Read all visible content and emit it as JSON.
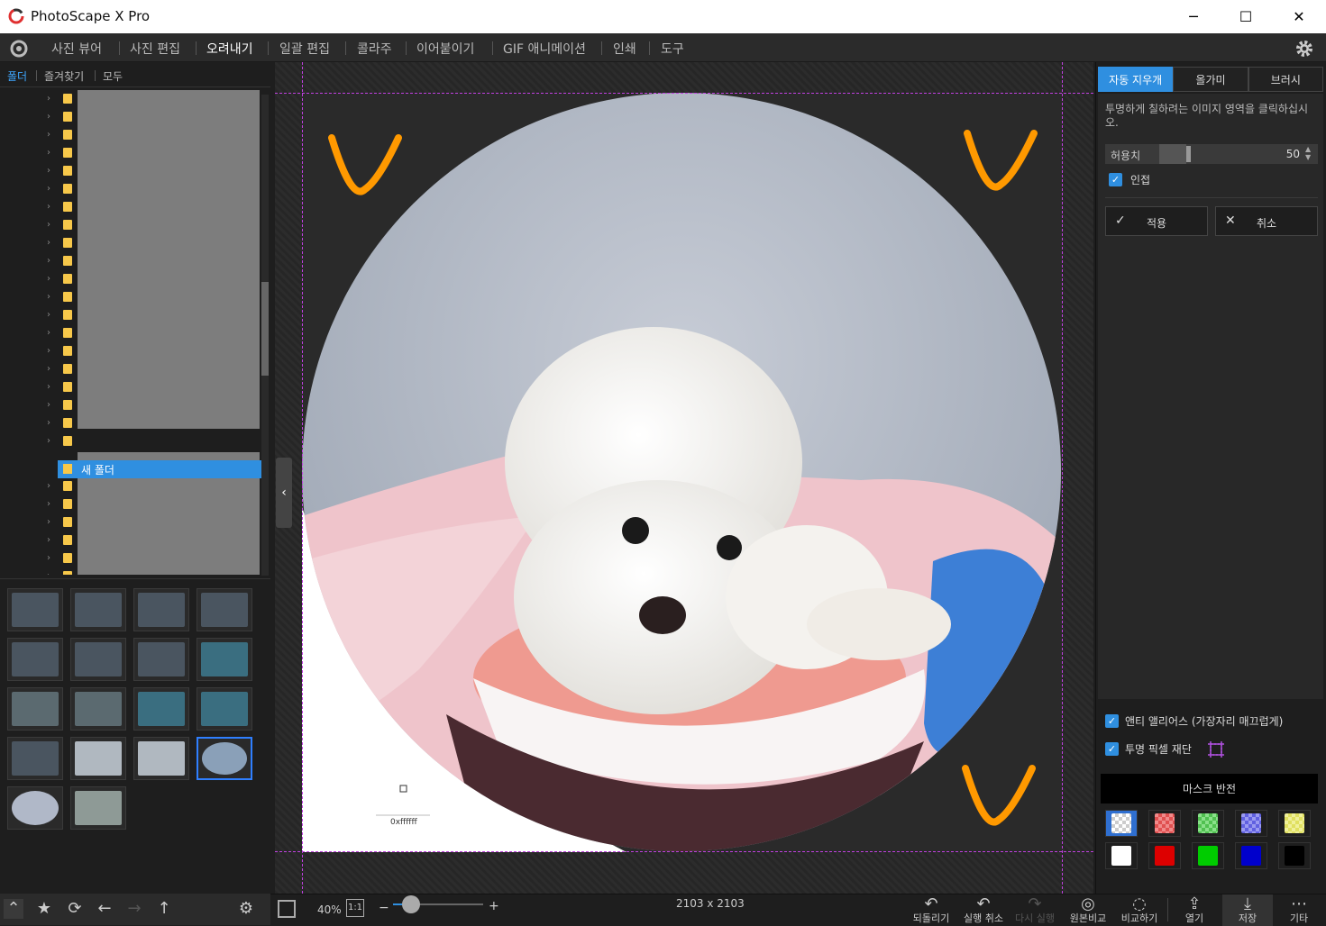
{
  "window": {
    "title": "PhotoScape X Pro"
  },
  "menu": {
    "items": [
      "사진 뷰어",
      "사진 편집",
      "오려내기",
      "일괄 편집",
      "콜라주",
      "이어붙이기",
      "GIF 애니메이션",
      "인쇄",
      "도구"
    ],
    "active_index": 2
  },
  "left_tabs": {
    "items": [
      "폴더",
      "즐겨찾기",
      "모두"
    ],
    "active_index": 0
  },
  "tree": {
    "selected_label": "새 폴더"
  },
  "right_tabs": {
    "items": [
      "자동 지우개",
      "올가미",
      "브러시"
    ],
    "active_index": 0
  },
  "auto_eraser": {
    "hint": "투명하게 칠하려는 이미지 영역을 클릭하십시오.",
    "tolerance_label": "허용치",
    "tolerance_value": "50",
    "tolerance_fraction": 0.5,
    "adjacent_label": "인접",
    "adjacent_checked": true,
    "apply_label": "적용",
    "cancel_label": "취소"
  },
  "options": {
    "antialias_label": "앤티 앨리어스 (가장자리 매끄럽게)",
    "antialias_checked": true,
    "trim_label": "투명 픽셀 재단",
    "trim_checked": true,
    "mask_invert_label": "마스크 반전"
  },
  "swatches": {
    "row1": [
      "checker",
      "#e05050",
      "#50c050",
      "#6060e0",
      "#e0e060"
    ],
    "row2": [
      "#ffffff",
      "#dd0000",
      "#00cc00",
      "#0000cc",
      "#000000"
    ],
    "selected": "checker"
  },
  "canvas": {
    "color_readout": "0xffffff"
  },
  "bottom": {
    "zoom": "40%",
    "actual_size_label": "1:1",
    "zoom_fraction": 0.2,
    "image_size": "2103 x 2103",
    "tools": [
      "되돌리기",
      "실행 취소",
      "다시 실행",
      "원본비교",
      "비교하기",
      "열기",
      "저장",
      "기타"
    ]
  },
  "colors": {
    "accent": "#2f8fe0",
    "selection": "#2f7fff",
    "guide": "#c040e0",
    "annotation": "#ff9900"
  }
}
